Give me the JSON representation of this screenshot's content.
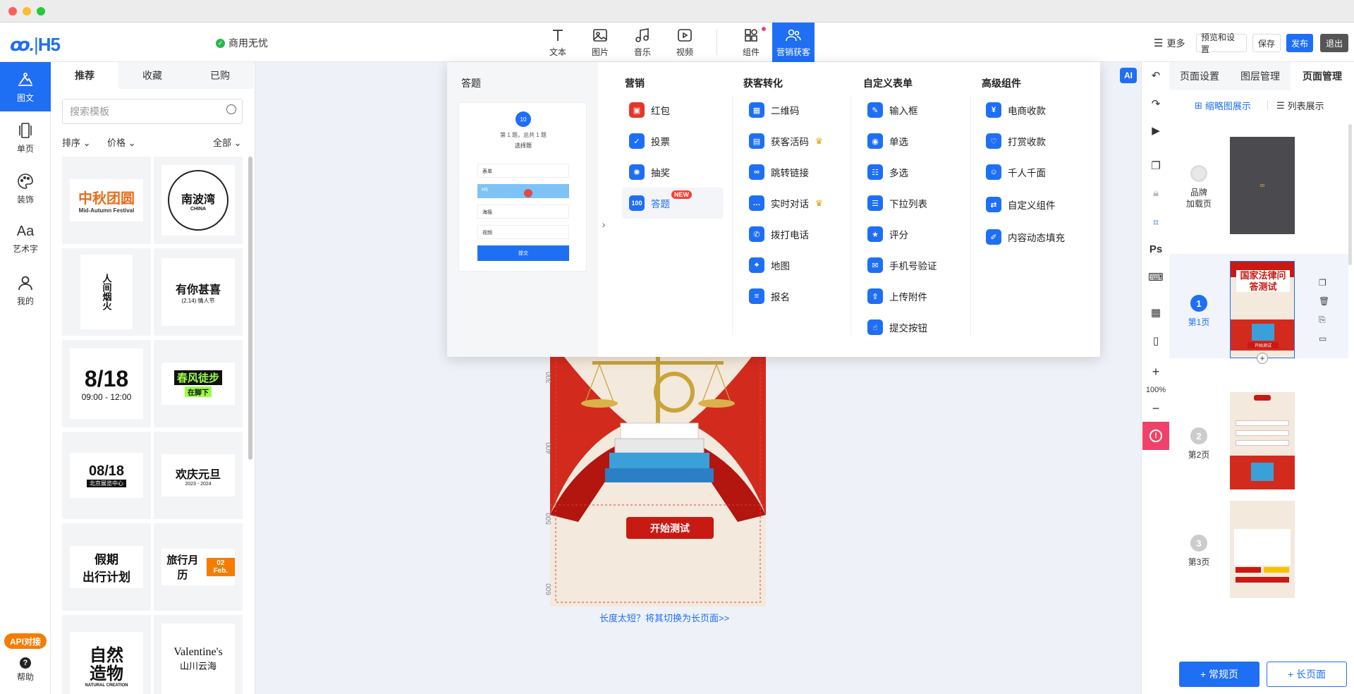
{
  "app": {
    "logo": "H5",
    "commercial_badge": "商用无忧"
  },
  "toolbar": {
    "tools": [
      {
        "icon": "text-icon",
        "label": "文本"
      },
      {
        "icon": "image-icon",
        "label": "图片"
      },
      {
        "icon": "music-icon",
        "label": "音乐"
      },
      {
        "icon": "video-icon",
        "label": "视频"
      },
      {
        "icon": "component-icon",
        "label": "组件"
      },
      {
        "icon": "marketing-icon",
        "label": "营销获客"
      }
    ],
    "more": "更多",
    "preview_settings": "预览和设置",
    "save": "保存",
    "publish": "发布",
    "exit": "退出"
  },
  "left_nav": {
    "items": [
      {
        "icon": "mountain-icon",
        "label": "图文"
      },
      {
        "icon": "page-icon",
        "label": "单页"
      },
      {
        "icon": "palette-icon",
        "label": "装饰"
      },
      {
        "icon": "font-icon",
        "label": "艺术字"
      },
      {
        "icon": "user-icon",
        "label": "我的"
      }
    ],
    "api_badge": "API对接",
    "help": "帮助"
  },
  "templates": {
    "tabs": [
      "推荐",
      "收藏",
      "已购"
    ],
    "search_placeholder": "搜索模板",
    "sort": "排序",
    "price": "价格",
    "all": "全部",
    "cards": [
      {
        "line1": "中秋团圆",
        "line2": "Mid-Autumn Festival"
      },
      {
        "line1": "南波湾",
        "line2": "CHINA"
      },
      {
        "line1": "人间烟火",
        "line2": ""
      },
      {
        "line1": "有你甚喜",
        "line2": "(2.14) 情人节"
      },
      {
        "line1": "8/18",
        "line2": "09:00 - 12:00"
      },
      {
        "line1": "春风徒步",
        "line2": "在脚下"
      },
      {
        "line1": "08/18",
        "line2": "北京展览中心"
      },
      {
        "line1": "欢庆元旦",
        "line2": "2023 - 2024"
      },
      {
        "line1": "假期",
        "line2": "出行计划"
      },
      {
        "line1": "旅行月历",
        "line2": "02 Feb."
      },
      {
        "line1": "自然造物",
        "line2": "NATURAL CREATION"
      },
      {
        "line1": "Valentine's",
        "line2": "山川云海"
      }
    ]
  },
  "dropdown": {
    "preview_title": "答题",
    "preview": {
      "badge": "10",
      "progress": "第 1 题，总共 1 题",
      "question": "选择题",
      "options": [
        "表单",
        "H5",
        "海报",
        "视频"
      ],
      "submit": "提交"
    },
    "columns": [
      {
        "title": "营销",
        "items": [
          {
            "icon": "redpacket-icon",
            "label": "红包"
          },
          {
            "icon": "vote-icon",
            "label": "投票"
          },
          {
            "icon": "lottery-icon",
            "label": "抽奖"
          },
          {
            "icon": "quiz-icon",
            "label": "答题",
            "tag": "NEW",
            "icon_text": "100"
          }
        ]
      },
      {
        "title": "获客转化",
        "items": [
          {
            "icon": "qrcode-icon",
            "label": "二维码"
          },
          {
            "icon": "livecode-icon",
            "label": "获客活码",
            "vip": true
          },
          {
            "icon": "link-icon",
            "label": "跳转链接"
          },
          {
            "icon": "chat-icon",
            "label": "实时对话",
            "vip": true
          },
          {
            "icon": "phone-icon",
            "label": "拨打电话"
          },
          {
            "icon": "map-icon",
            "label": "地图"
          },
          {
            "icon": "signup-icon",
            "label": "报名"
          }
        ]
      },
      {
        "title": "自定义表单",
        "items": [
          {
            "icon": "input-icon",
            "label": "输入框"
          },
          {
            "icon": "radio-icon",
            "label": "单选"
          },
          {
            "icon": "checkbox-icon",
            "label": "多选"
          },
          {
            "icon": "dropdown-list-icon",
            "label": "下拉列表"
          },
          {
            "icon": "star-icon",
            "label": "评分"
          },
          {
            "icon": "sms-icon",
            "label": "手机号验证"
          },
          {
            "icon": "upload-icon",
            "label": "上传附件"
          },
          {
            "icon": "submit-icon",
            "label": "提交按钮"
          }
        ]
      },
      {
        "title": "高级组件",
        "items": [
          {
            "icon": "ecommerce-icon",
            "label": "电商收款"
          },
          {
            "icon": "reward-icon",
            "label": "打赏收款"
          },
          {
            "icon": "people-icon",
            "label": "千人千面"
          },
          {
            "icon": "custom-component-icon",
            "label": "自定义组件"
          },
          {
            "icon": "dynamic-fill-icon",
            "label": "内容动态填充"
          }
        ]
      }
    ]
  },
  "canvas": {
    "ruler_marks": [
      "300",
      "400",
      "500",
      "600"
    ],
    "start_button": "开始测试",
    "switch_link": "长度太短？将其切换为长页面>>"
  },
  "right_tools": {
    "ai": "AI",
    "ps": "Ps",
    "zoom": "100%"
  },
  "page_panel": {
    "tabs": [
      "页面设置",
      "图层管理",
      "页面管理"
    ],
    "thumbnail_view": "缩略图展示",
    "list_view": "列表展示",
    "loading_page_label_1": "品牌",
    "loading_page_label_2": "加载页",
    "pages": [
      {
        "num": "1",
        "label": "第1页",
        "title": "国家法律问答测试",
        "start": "开始测试"
      },
      {
        "num": "2",
        "label": "第2页"
      },
      {
        "num": "3",
        "label": "第3页"
      }
    ],
    "add_normal": "+ 常规页",
    "add_long": "+ 长页面"
  },
  "colors": {
    "accent": "#1f6ff5",
    "danger": "#c81a12",
    "publish": "#1f6ff5",
    "exit": "#555555",
    "new_tag": "#ff3b30"
  }
}
